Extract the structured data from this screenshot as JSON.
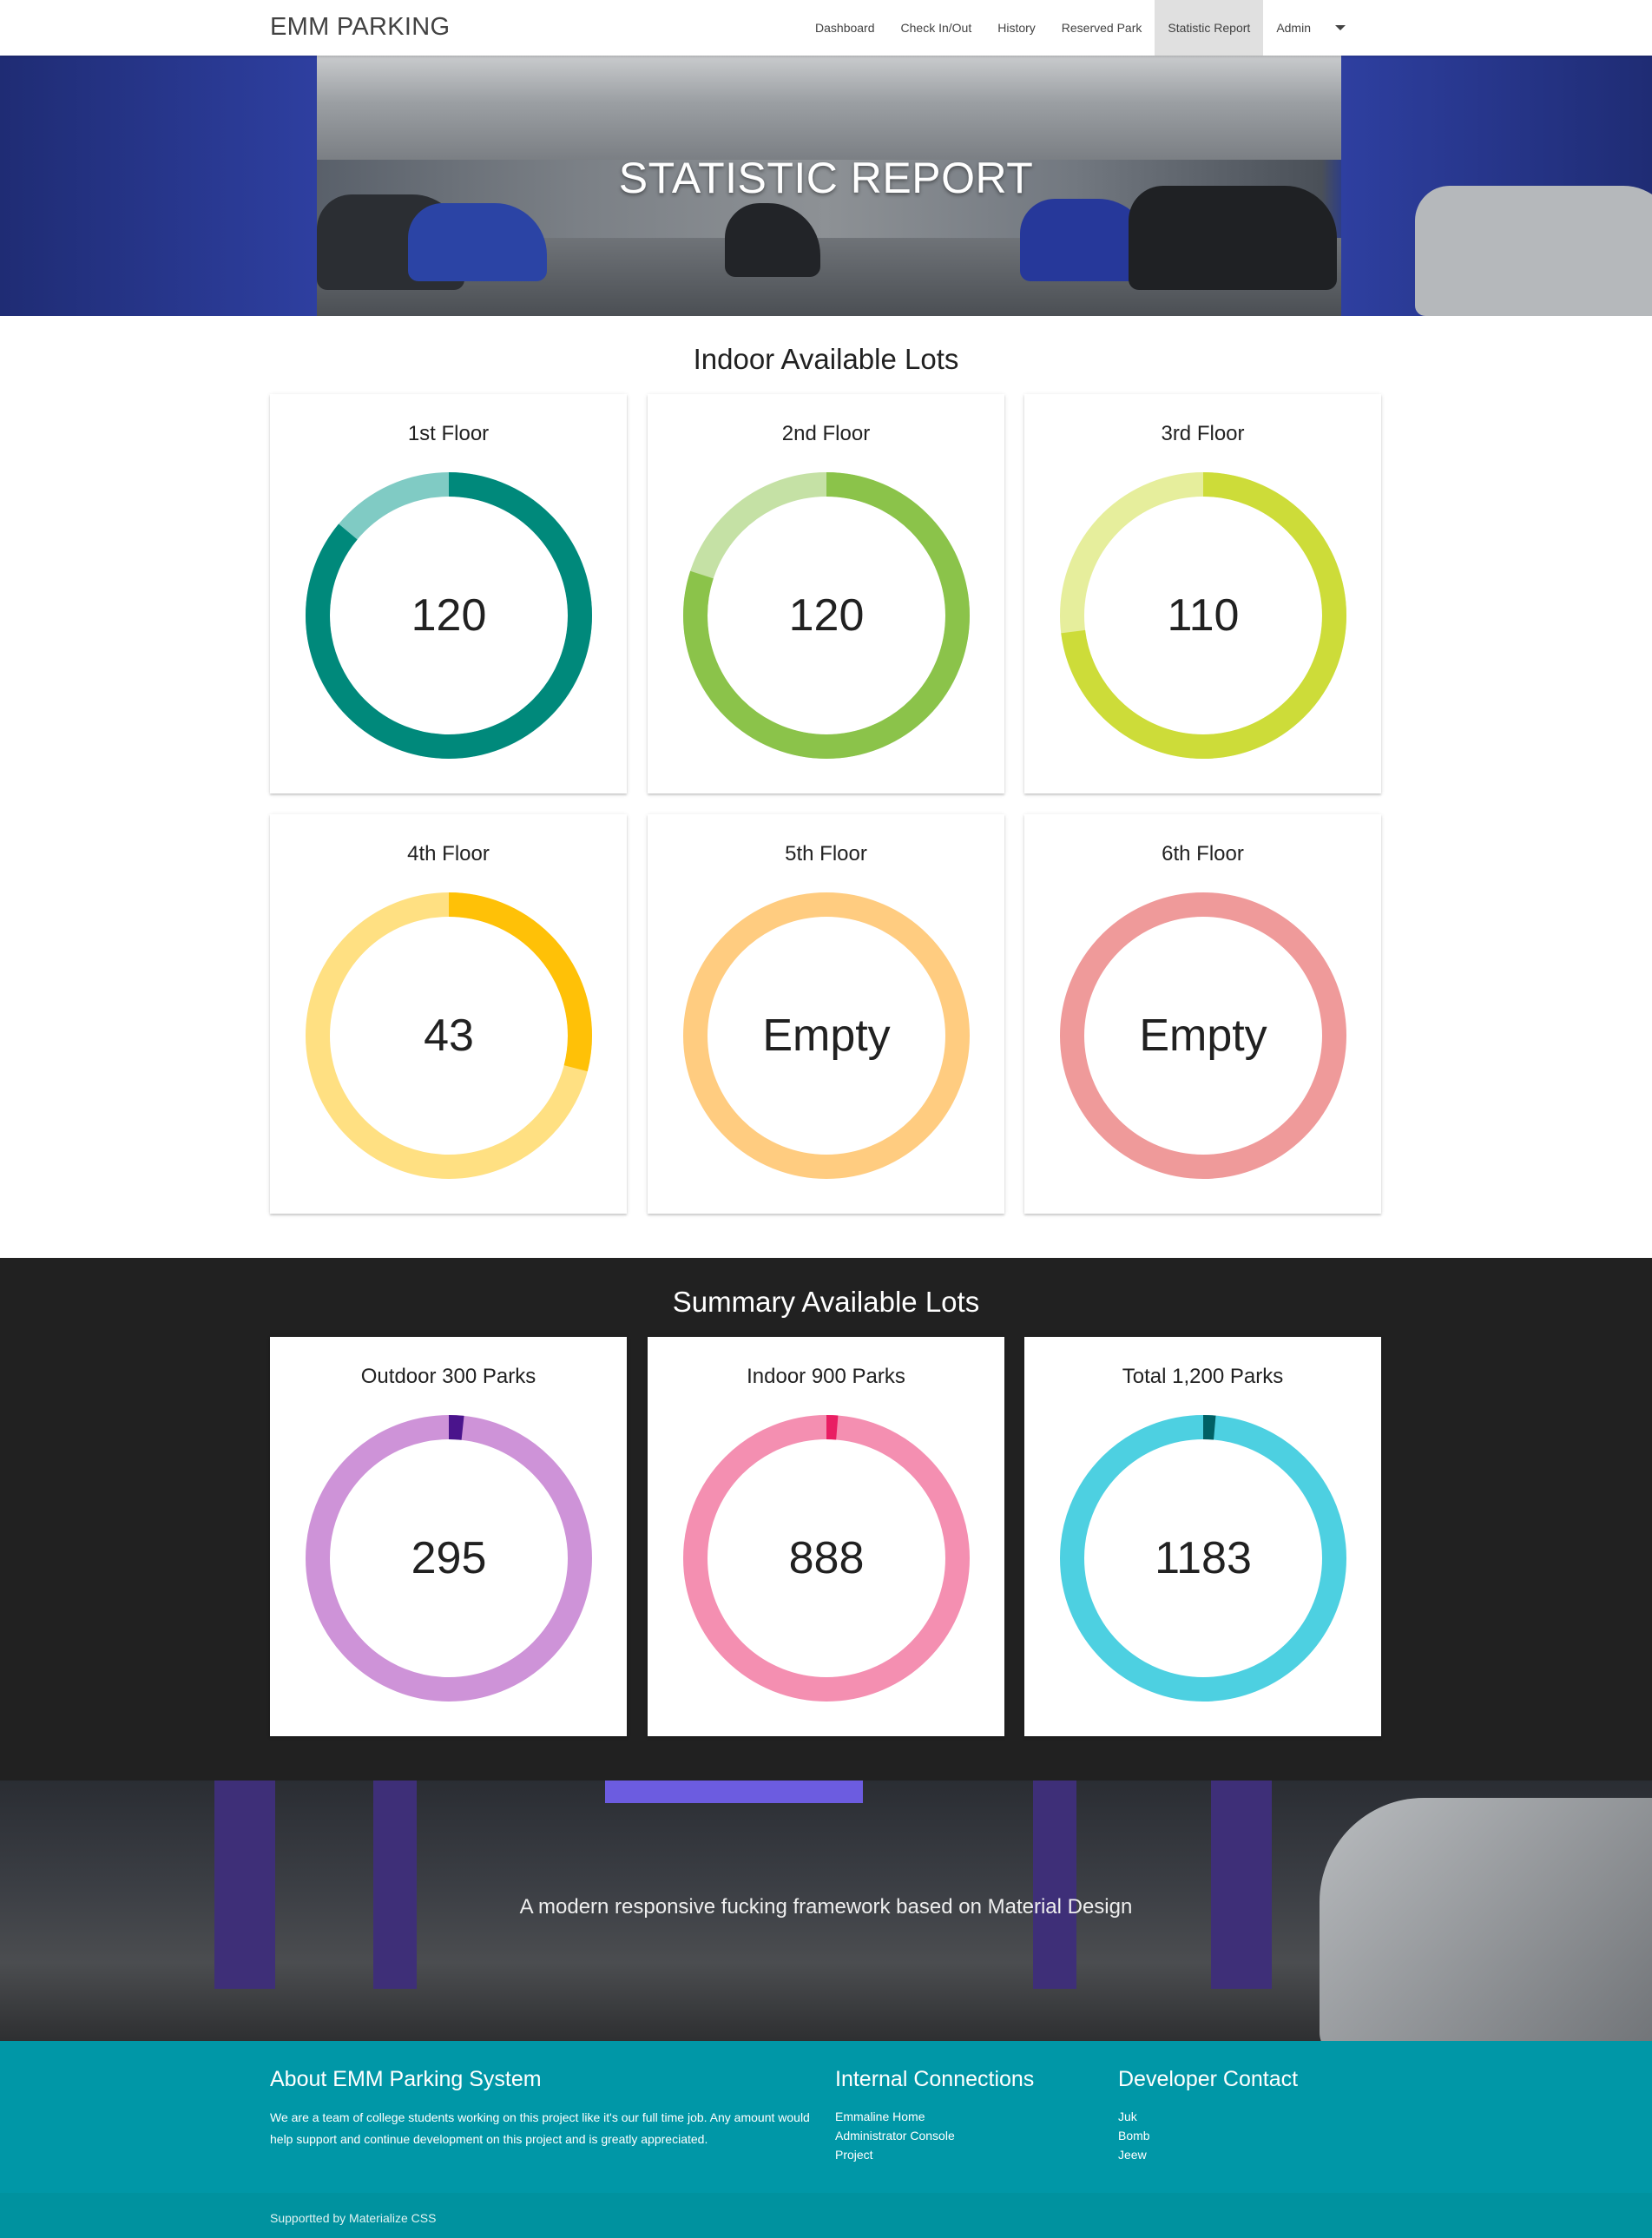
{
  "nav": {
    "brand": "EMM PARKING",
    "links": [
      "Dashboard",
      "Check In/Out",
      "History",
      "Reserved Park",
      "Statistic Report",
      "Admin"
    ]
  },
  "hero": {
    "title": "STATISTIC REPORT"
  },
  "indoor": {
    "title": "Indoor Available Lots",
    "floors": [
      {
        "name": "1st Floor",
        "value": "120",
        "fraction": 0.86,
        "main": "#00897b",
        "light": "#80cbc4"
      },
      {
        "name": "2nd Floor",
        "value": "120",
        "fraction": 0.8,
        "main": "#8bc34a",
        "light": "#c5e1a5"
      },
      {
        "name": "3rd Floor",
        "value": "110",
        "fraction": 0.73,
        "main": "#cddc39",
        "light": "#e6ee9c"
      },
      {
        "name": "4th Floor",
        "value": "43",
        "fraction": 0.29,
        "main": "#ffc107",
        "light": "#ffe082"
      },
      {
        "name": "5th Floor",
        "value": "Empty",
        "fraction": 0,
        "main": "#ffb74d",
        "light": "#ffcc80"
      },
      {
        "name": "6th Floor",
        "value": "Empty",
        "fraction": 0,
        "main": "#e57373",
        "light": "#ef9a9a"
      }
    ]
  },
  "summary": {
    "title": "Summary Available Lots",
    "items": [
      {
        "name": "Outdoor 300 Parks",
        "value": "295",
        "fraction": 0.017,
        "main": "#4a148c",
        "light": "#ce93d8"
      },
      {
        "name": "Indoor 900 Parks",
        "value": "888",
        "fraction": 0.013,
        "main": "#e91e63",
        "light": "#f48fb1"
      },
      {
        "name": "Total 1,200 Parks",
        "value": "1183",
        "fraction": 0.014,
        "main": "#006064",
        "light": "#4dd0e1"
      }
    ]
  },
  "banner": {
    "text": "A modern responsive fucking framework based on Material Design"
  },
  "footer": {
    "about_title": "About EMM Parking System",
    "about_text": "We are a team of college students working on this project like it's our full time job. Any amount would help support and continue development on this project and is greatly appreciated.",
    "connections_title": "Internal Connections",
    "connections": [
      "Emmaline Home",
      "Administrator Console",
      "Project"
    ],
    "contact_title": "Developer Contact",
    "contacts": [
      "Juk",
      "Bomb",
      "Jeew"
    ],
    "copyright": "Supportted by Materialize CSS"
  }
}
